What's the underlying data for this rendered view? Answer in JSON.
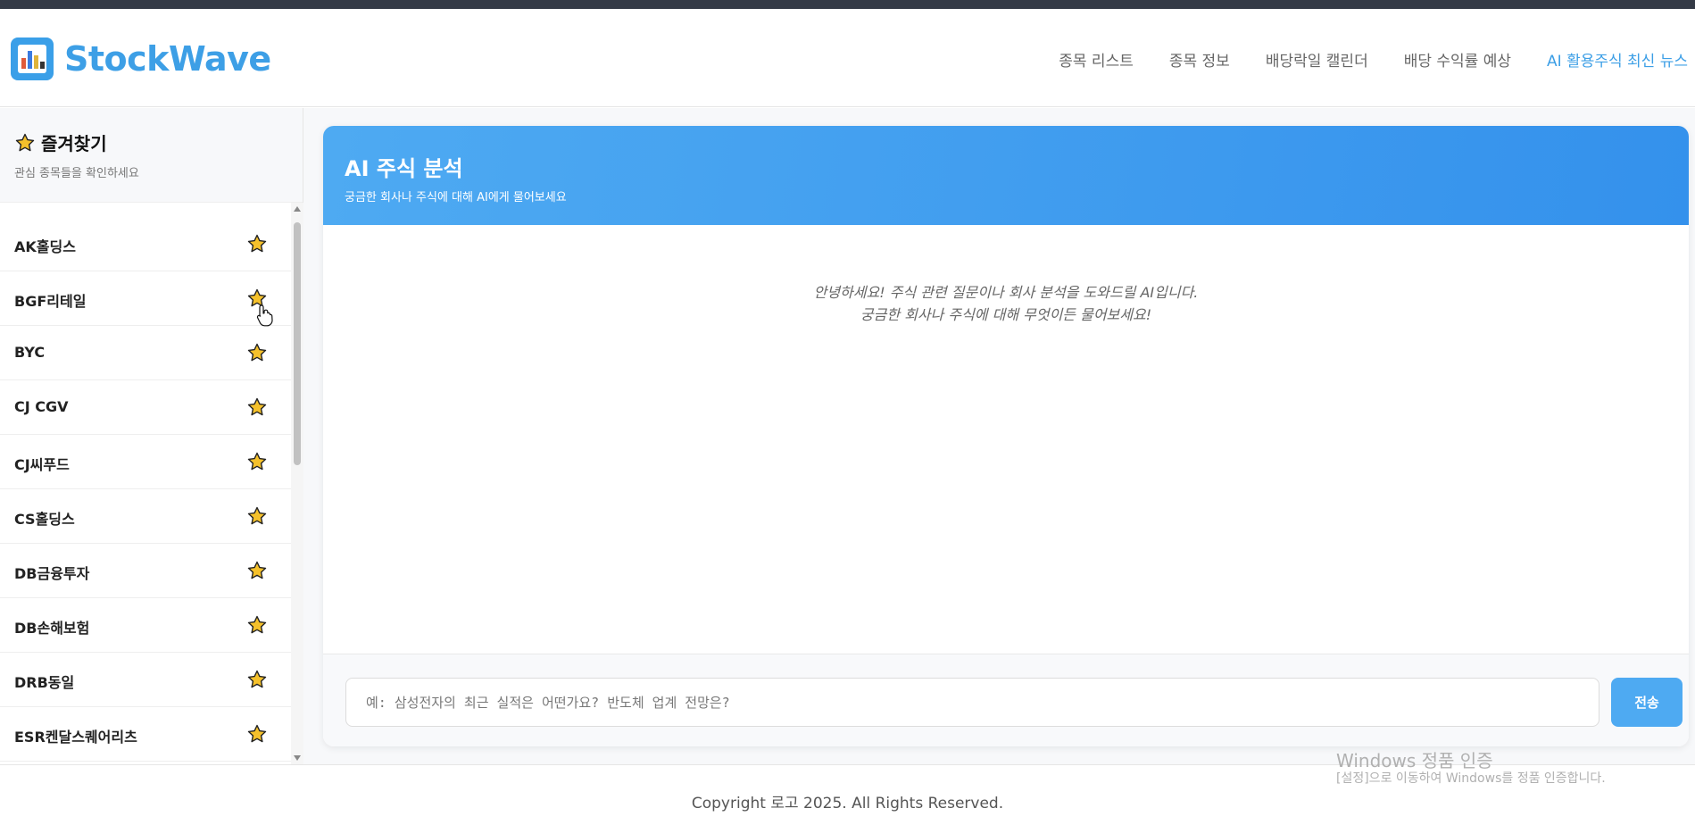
{
  "brand": {
    "name": "StockWave",
    "icon": "bar-chart-icon",
    "color": "#3d9fe6"
  },
  "nav": {
    "items": [
      {
        "label": "종목 리스트",
        "active": false
      },
      {
        "label": "종목 정보",
        "active": false
      },
      {
        "label": "배당락일 캘린더",
        "active": false
      },
      {
        "label": "배당 수익률 예상",
        "active": false
      },
      {
        "label": "AI 활용주식 최신 뉴스",
        "active": true
      }
    ]
  },
  "sidebar": {
    "title": "즐겨찾기",
    "title_icon": "star-icon",
    "subtitle": "관심 종목들을 확인하세요",
    "items": [
      {
        "name": "AK홀딩스"
      },
      {
        "name": "BGF리테일"
      },
      {
        "name": "BYC"
      },
      {
        "name": "CJ CGV"
      },
      {
        "name": "CJ씨푸드"
      },
      {
        "name": "CS홀딩스"
      },
      {
        "name": "DB금융투자"
      },
      {
        "name": "DB손해보험"
      },
      {
        "name": "DRB동일"
      },
      {
        "name": "ESR켄달스퀘어리츠"
      }
    ]
  },
  "chat": {
    "title": "AI 주식 분석",
    "subtitle": "궁금한 회사나 주식에 대해 AI에게 물어보세요",
    "greeting_line1": "안녕하세요! 주식 관련 질문이나 회사 분석을 도와드릴 AI입니다.",
    "greeting_line2": "궁금한 회사나 주식에 대해 무엇이든 물어보세요!",
    "input_placeholder": "예: 삼성전자의 최근 실적은 어떤가요? 반도체 업계 전망은?",
    "send_label": "전송",
    "header_color": "#4eaaf2"
  },
  "footer": {
    "copyright": "Copyright 로고 2025. All Rights Reserved."
  },
  "watermark": {
    "line1": "Windows 정품 인증",
    "line2": "[설정]으로 이동하여 Windows를 정품 인증합니다."
  }
}
